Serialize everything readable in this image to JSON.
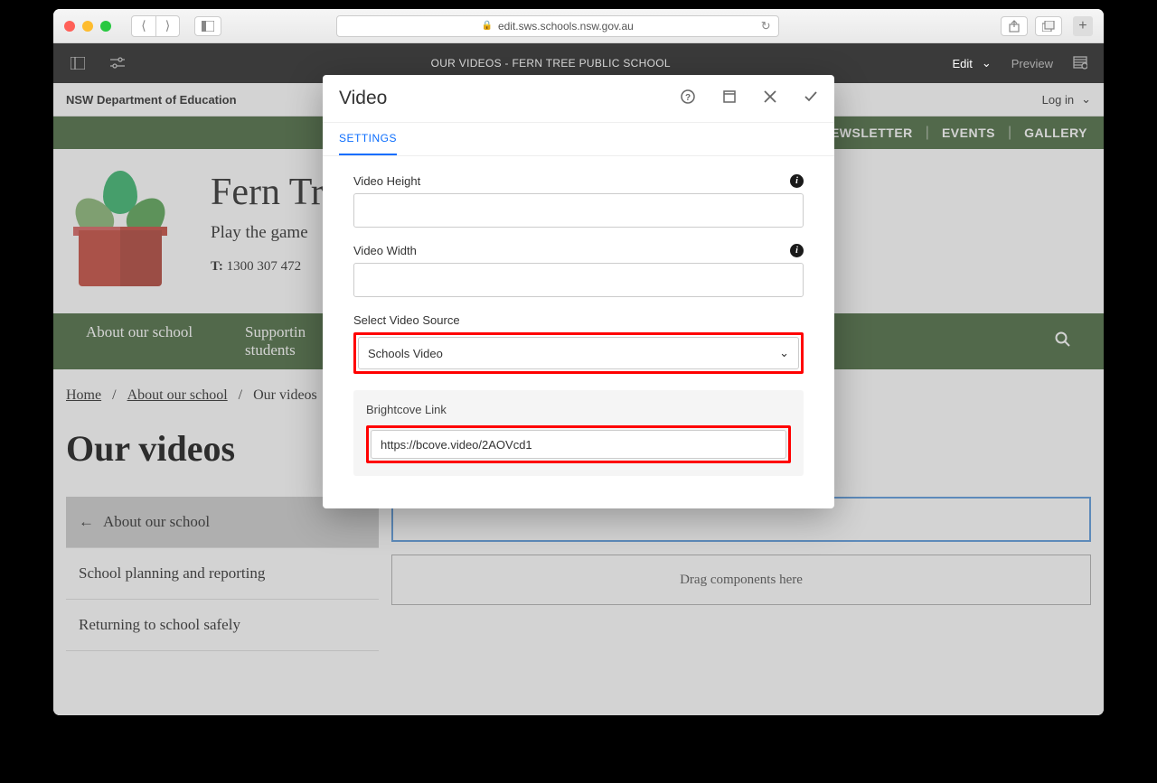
{
  "browser": {
    "url": "edit.sws.schools.nsw.gov.au"
  },
  "cms": {
    "title": "OUR VIDEOS - FERN TREE PUBLIC SCHOOL",
    "edit": "Edit",
    "preview": "Preview"
  },
  "topbar": {
    "department": "NSW Department of Education",
    "login": "Log in"
  },
  "navstrip": {
    "newsletter": "NEWSLETTER",
    "events": "EVENTS",
    "gallery": "GALLERY"
  },
  "header": {
    "school_name": "Fern Tre",
    "tagline": "Play the game",
    "phone_label": "T:",
    "phone_number": " 1300 307 472"
  },
  "mainnav": {
    "about": "About our school",
    "supporting": "Supportin\nstudents"
  },
  "breadcrumb": {
    "home": "Home",
    "about": "About our school",
    "current": "Our videos"
  },
  "page": {
    "title": "Our videos"
  },
  "sidebar": {
    "items": [
      {
        "label": "About our school",
        "icon": "←"
      },
      {
        "label": "School planning and reporting"
      },
      {
        "label": "Returning to school safely"
      }
    ]
  },
  "dropzone": {
    "text": "Drag components here"
  },
  "modal": {
    "title": "Video",
    "tab": "SETTINGS",
    "fields": {
      "video_height_label": "Video Height",
      "video_height_value": "",
      "video_width_label": "Video Width",
      "video_width_value": "",
      "source_label": "Select Video Source",
      "source_value": "Schools Video",
      "brightcove_label": "Brightcove Link",
      "brightcove_value": "https://bcove.video/2AOVcd1"
    }
  }
}
